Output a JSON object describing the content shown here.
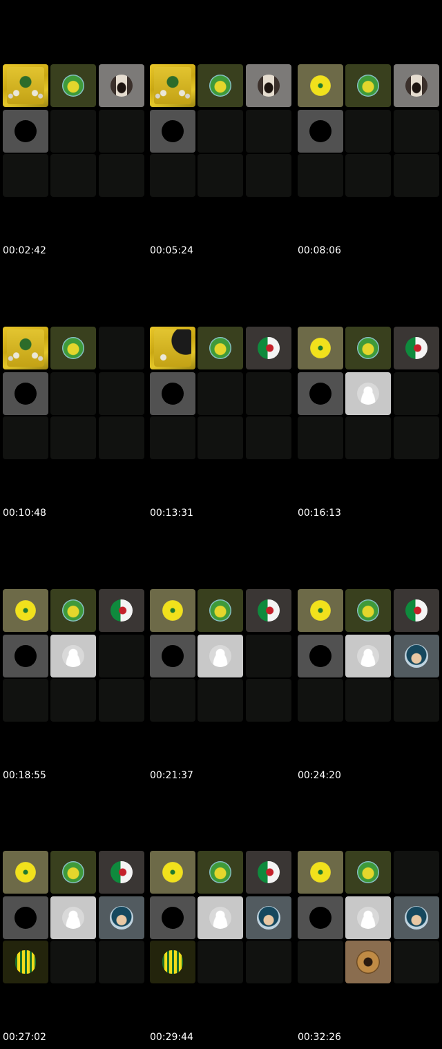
{
  "timestamps": [
    "00:02:42",
    "00:05:24",
    "00:08:06",
    "00:10:48",
    "00:13:31",
    "00:16:13",
    "00:18:55",
    "00:21:37",
    "00:24:20",
    "00:27:02",
    "00:29:44",
    "00:32:26"
  ],
  "tile_kinds": {
    "trophy": "team-trophy-photo",
    "trophy2": "team-trophy-photo-with-hand",
    "green": "green-crest-avatar",
    "shirt": "yellow-jersey-avatar",
    "monument": "monument-avatar",
    "flag": "algeria-flag-avatar",
    "dark": "black-circle-avatar",
    "user": "default-user-avatar",
    "pilot": "cartoon-pilot-avatar",
    "badge": "striped-badge-avatar",
    "copper": "copper-logo-avatar",
    "empty": "empty-slot"
  },
  "panels": [
    [
      "trophy",
      "green",
      "monument",
      "dark",
      "empty",
      "empty",
      "empty",
      "empty",
      "empty"
    ],
    [
      "trophy",
      "green",
      "monument",
      "dark",
      "empty",
      "empty",
      "empty",
      "empty",
      "empty"
    ],
    [
      "shirt",
      "green",
      "monument",
      "dark",
      "empty",
      "empty",
      "empty",
      "empty",
      "empty"
    ],
    [
      "trophy",
      "green",
      "empty",
      "dark",
      "empty",
      "empty",
      "empty",
      "empty",
      "empty"
    ],
    [
      "trophy2",
      "green",
      "flag",
      "dark",
      "empty",
      "empty",
      "empty",
      "empty",
      "empty"
    ],
    [
      "shirt",
      "green",
      "flag",
      "dark",
      "user",
      "empty",
      "empty",
      "empty",
      "empty"
    ],
    [
      "shirt",
      "green",
      "flag",
      "dark",
      "user",
      "empty",
      "empty",
      "empty",
      "empty"
    ],
    [
      "shirt",
      "green",
      "flag",
      "dark",
      "user",
      "empty",
      "empty",
      "empty",
      "empty"
    ],
    [
      "shirt",
      "green",
      "flag",
      "dark",
      "user",
      "pilot",
      "empty",
      "empty",
      "empty"
    ],
    [
      "shirt",
      "green",
      "flag",
      "dark",
      "user",
      "pilot",
      "badge",
      "empty",
      "empty"
    ],
    [
      "shirt",
      "green",
      "flag",
      "dark",
      "user",
      "pilot",
      "badge",
      "empty",
      "empty"
    ],
    [
      "shirt",
      "green",
      "empty",
      "dark",
      "user",
      "pilot",
      "empty",
      "copper",
      "empty"
    ]
  ],
  "colors": {
    "background": "#000000",
    "empty_slot": "#111210",
    "timestamp_text": "#ffffff"
  }
}
